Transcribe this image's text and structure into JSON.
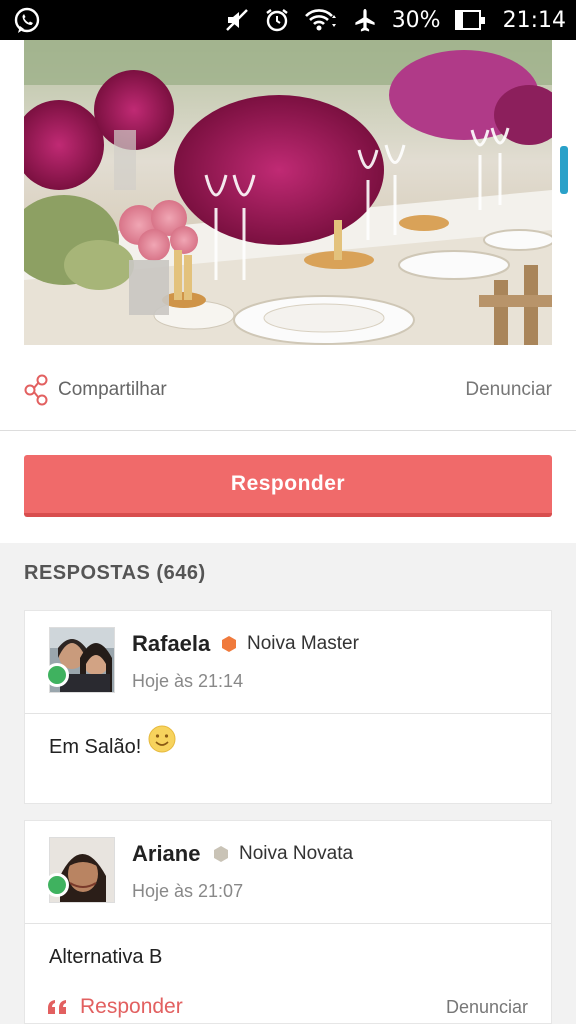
{
  "status_bar": {
    "battery": "30%",
    "time": "21:14",
    "icons": [
      "whatsapp-icon",
      "mute-icon",
      "alarm-icon",
      "wifi-icon",
      "airplane-icon",
      "battery-icon"
    ]
  },
  "post": {
    "share_label": "Compartilhar",
    "report_label": "Denunciar",
    "reply_button": "Responder"
  },
  "answers": {
    "title": "RESPOSTAS (646)",
    "items": [
      {
        "name": "Rafaela",
        "rank": "Noiva Master",
        "rank_color": "#f07a3c",
        "time": "Hoje às 21:14",
        "text": "Em Salão!",
        "emoji": "smiley-emoji"
      },
      {
        "name": "Ariane",
        "rank": "Noiva Novata",
        "rank_color": "#c9c3b6",
        "time": "Hoje às 21:07",
        "text": "Alternativa B",
        "reply_label": "Responder",
        "report_label": "Denunciar"
      }
    ]
  },
  "colors": {
    "accent": "#f06a6a",
    "online": "#3fb25f"
  }
}
